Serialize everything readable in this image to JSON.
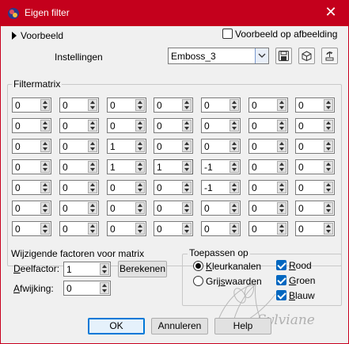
{
  "window": {
    "title": "Eigen filter",
    "close_glyph": "✕"
  },
  "preview": {
    "toggle_label": "Voorbeeld",
    "checkbox_label": "Voorbeeld op afbeelding",
    "checked": false
  },
  "settings": {
    "label": "Instellingen",
    "preset_value": "Emboss_3",
    "icons": [
      "save-preset-icon",
      "reset-cube-icon",
      "restore-icon"
    ]
  },
  "matrix": {
    "title": "Filtermatrix",
    "rows": [
      [
        "0",
        "0",
        "0",
        "0",
        "0",
        "0",
        "0"
      ],
      [
        "0",
        "0",
        "0",
        "0",
        "0",
        "0",
        "0"
      ],
      [
        "0",
        "0",
        "1",
        "0",
        "0",
        "0",
        "0"
      ],
      [
        "0",
        "0",
        "1",
        "1",
        "-1",
        "0",
        "0"
      ],
      [
        "0",
        "0",
        "0",
        "0",
        "-1",
        "0",
        "0"
      ],
      [
        "0",
        "0",
        "0",
        "0",
        "0",
        "0",
        "0"
      ],
      [
        "0",
        "0",
        "0",
        "0",
        "0",
        "0",
        "0"
      ]
    ]
  },
  "factors": {
    "title": "Wijzigende factoren voor matrix",
    "divisor_label": "Deelfactor:",
    "divisor_value": "1",
    "calculate_button": "Berekenen",
    "bias_label": "Afwijking:",
    "bias_value": "0"
  },
  "apply": {
    "title": "Toepassen op",
    "options": [
      {
        "label": "Kleurkanalen",
        "selected": true
      },
      {
        "label": "Grijswaarden",
        "selected": false
      }
    ],
    "channels": [
      {
        "label": "Rood",
        "checked": true
      },
      {
        "label": "Groen",
        "checked": true
      },
      {
        "label": "Blauw",
        "checked": true
      }
    ]
  },
  "watermark_text": "Sylviane",
  "buttons": {
    "ok": "OK",
    "cancel": "Annuleren",
    "help": "Help"
  },
  "colors": {
    "titlebar": "#c4001c",
    "accent": "#0067c0"
  }
}
